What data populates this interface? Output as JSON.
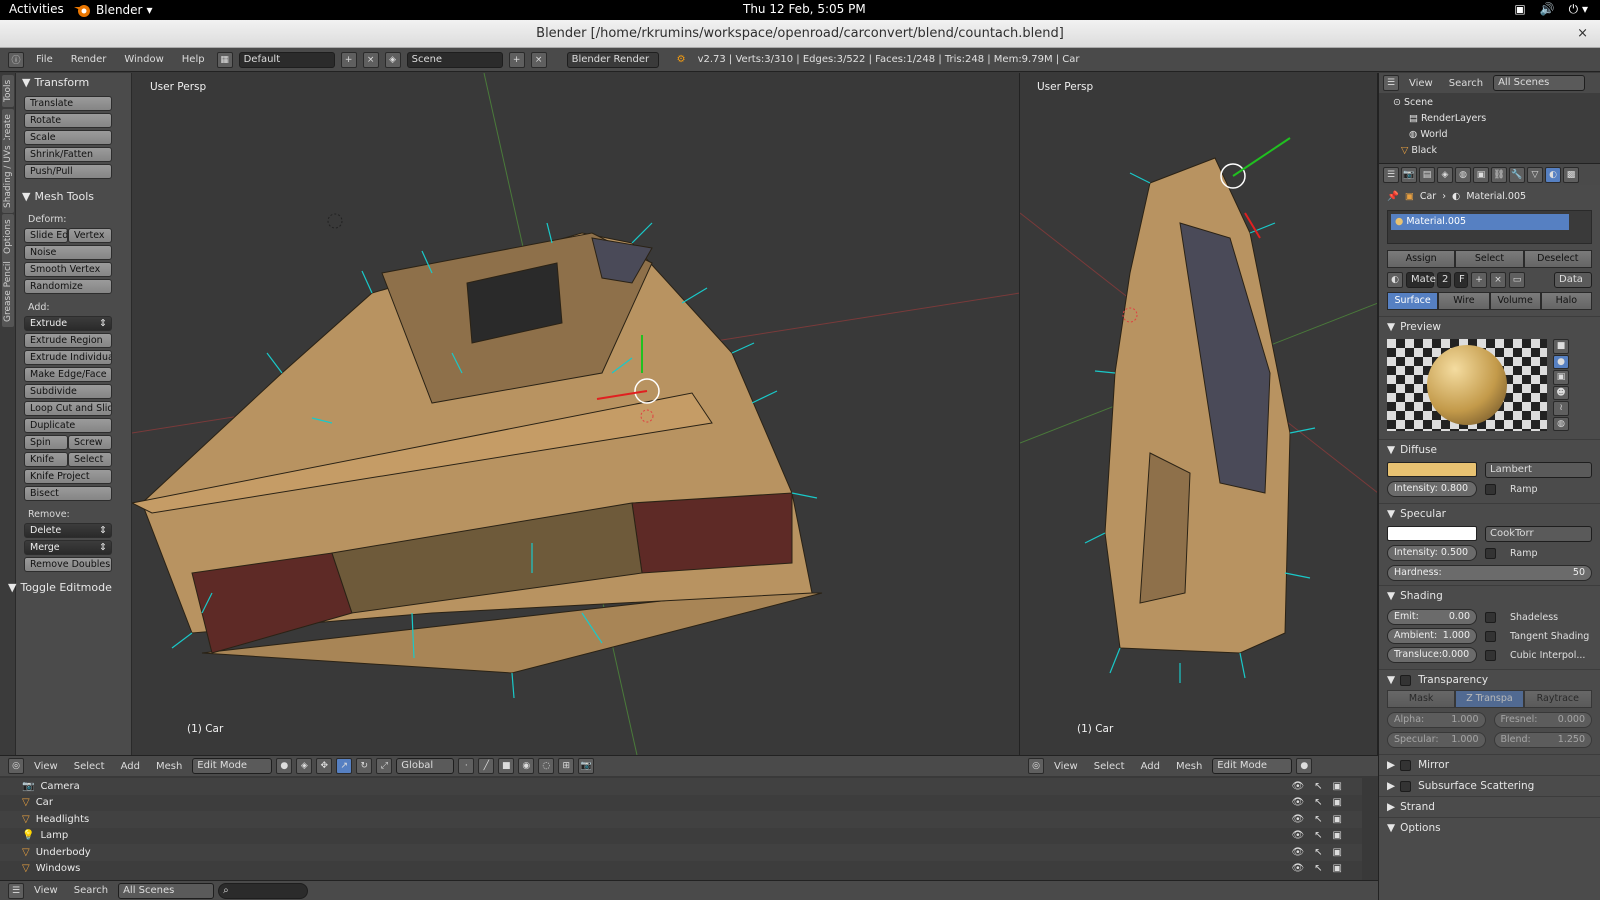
{
  "system_bar": {
    "activities": "Activities",
    "app_name": "Blender",
    "clock": "Thu 12 Feb,  5:05 PM"
  },
  "window": {
    "title": "Blender [/home/rkrumins/workspace/openroad/carconvert/blend/countach.blend]"
  },
  "info_header": {
    "menus": [
      "File",
      "Render",
      "Window",
      "Help"
    ],
    "layout": "Default",
    "scene": "Scene",
    "engine": "Blender Render",
    "stats": "v2.73 | Verts:3/310 | Edges:3/522 | Faces:1/248 | Tris:248 | Mem:9.79M | Car"
  },
  "side_tabs": [
    "Tools",
    "Create",
    "Shading / UVs",
    "Options",
    "Grease Pencil"
  ],
  "tool_shelf": {
    "transform_title": "Transform",
    "transform_buttons": [
      "Translate",
      "Rotate",
      "Scale",
      "Shrink/Fatten",
      "Push/Pull"
    ],
    "mesh_tools_title": "Mesh Tools",
    "deform_label": "Deform:",
    "deform_row": [
      "Slide Ed",
      "Vertex"
    ],
    "deform_buttons": [
      "Noise",
      "Smooth Vertex",
      "Randomize"
    ],
    "add_label": "Add:",
    "extrude": "Extrude",
    "add_buttons": [
      "Extrude Region",
      "Extrude Individual",
      "Make Edge/Face",
      "Subdivide",
      "Loop Cut and Slide",
      "Duplicate"
    ],
    "spin_row": [
      "Spin",
      "Screw"
    ],
    "knife_row": [
      "Knife",
      "Select"
    ],
    "add_buttons2": [
      "Knife Project",
      "Bisect"
    ],
    "remove_label": "Remove:",
    "delete": "Delete",
    "merge": "Merge",
    "remove_doubles": "Remove Doubles",
    "toggle_editmode": "Toggle Editmode"
  },
  "viewports": [
    {
      "label": "User Persp",
      "object": "(1) Car"
    },
    {
      "label": "User Persp",
      "object": "(1) Car"
    }
  ],
  "view3d_header": {
    "menus": [
      "View",
      "Select",
      "Add",
      "Mesh"
    ],
    "mode": "Edit Mode",
    "orientation": "Global"
  },
  "outliner": {
    "items": [
      "Camera",
      "Car",
      "Headlights",
      "Lamp",
      "Underbody",
      "Windows"
    ],
    "menus": [
      "View",
      "Search"
    ],
    "filter": "All Scenes"
  },
  "top_outliner": {
    "menus": [
      "View",
      "Search"
    ],
    "filter": "All Scenes",
    "items": [
      "Scene",
      "RenderLayers",
      "World",
      "Black"
    ]
  },
  "properties": {
    "breadcrumb": [
      "Car",
      "Material.005"
    ],
    "slot_name": "Material.005",
    "slot_buttons": [
      "Assign",
      "Select",
      "Deselect"
    ],
    "material_short": "Mate",
    "users": "2",
    "fake": "F",
    "link": "Data",
    "tabs": [
      "Surface",
      "Wire",
      "Volume",
      "Halo"
    ],
    "active_tab": "Surface",
    "preview_title": "Preview",
    "diffuse_title": "Diffuse",
    "diffuse_color": "#e8c272",
    "diffuse_shader": "Lambert",
    "diffuse_intensity": "Intensity: 0.800",
    "ramp": "Ramp",
    "specular_title": "Specular",
    "specular_color": "#ffffff",
    "specular_shader": "CookTorr",
    "specular_intensity": "Intensity: 0.500",
    "hardness_label": "Hardness:",
    "hardness_value": "50",
    "shading_title": "Shading",
    "emit": "Emit:",
    "emit_value": "0.00",
    "ambient": "Ambient:",
    "ambient_value": "1.000",
    "translucency": "Translucе:0.000",
    "shadeless": "Shadeless",
    "tangent": "Tangent Shading",
    "cubic": "Cubic Interpol...",
    "transparency_title": "Transparency",
    "transparency_modes": [
      "Mask",
      "Z Transpa",
      "Raytrace"
    ],
    "alpha": "Alpha:",
    "alpha_value": "1.000",
    "fresnel": "Fresnel:",
    "fresnel_value": "0.000",
    "specular_t": "Specular:",
    "specular_t_value": "1.000",
    "blend": "Blend:",
    "blend_value": "1.250",
    "mirror_title": "Mirror",
    "sss_title": "Subsurface Scattering",
    "strand_title": "Strand",
    "options_title": "Options"
  }
}
